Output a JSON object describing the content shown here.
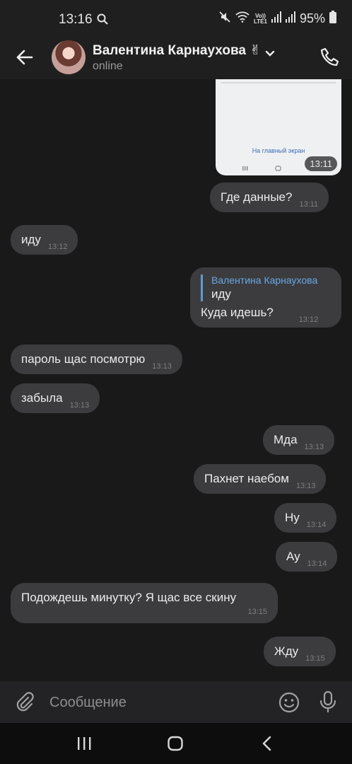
{
  "status_bar": {
    "time": "13:16",
    "network_top": "Vo))",
    "network_bottom": "LTE1",
    "battery": "95%"
  },
  "header": {
    "name": "Валентина Карнаухова ✌",
    "status": "online"
  },
  "image_message": {
    "link_text": "На главный экран",
    "time": "13:11"
  },
  "messages": [
    {
      "dir": "out",
      "text": "Где данные?",
      "time": "13:11"
    },
    {
      "dir": "in",
      "text": "иду",
      "time": "13:12"
    },
    {
      "dir": "out",
      "reply_to_name": "Валентина Карнаухова",
      "reply_to_text": "иду",
      "text": "Куда идешь?",
      "time": "13:12"
    },
    {
      "dir": "in",
      "text": "пароль щас посмотрю",
      "time": "13:13"
    },
    {
      "dir": "in",
      "text": "забыла",
      "time": "13:13"
    },
    {
      "dir": "out",
      "text": "Мда",
      "time": "13:13"
    },
    {
      "dir": "out",
      "text": "Пахнет наебом",
      "time": "13:13"
    },
    {
      "dir": "out",
      "text": "Ну",
      "time": "13:14"
    },
    {
      "dir": "out",
      "text": "Ау",
      "time": "13:14"
    },
    {
      "dir": "in",
      "text": "Подождешь минутку? Я щас все скину",
      "time": "13:15"
    },
    {
      "dir": "out",
      "text": "Жду",
      "time": "13:15"
    }
  ],
  "composer": {
    "placeholder": "Сообщение"
  },
  "icons": {
    "back": "arrow-left-icon",
    "call": "phone-icon",
    "attach": "paperclip-icon",
    "emoji": "smiley-icon",
    "mic": "microphone-icon"
  }
}
